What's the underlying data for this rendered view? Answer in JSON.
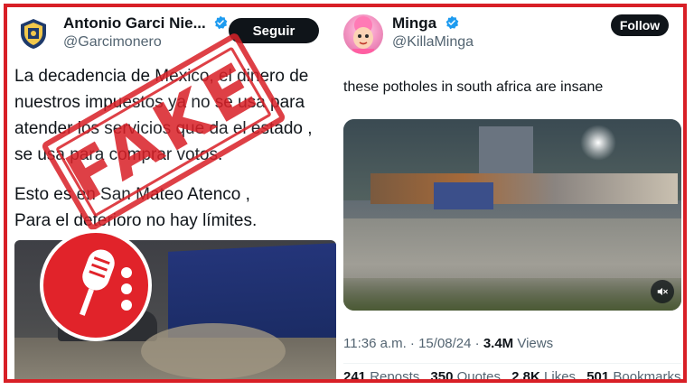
{
  "left_tweet": {
    "name": "Antonio Garci Nie...",
    "handle": "@Garcimonero",
    "follow_label": "Seguir",
    "text_lines": [
      "La decadencia de Mexico, el dinero de",
      "nuestros impuestos ya no se usa para",
      "atender los servicios que da el estado ,",
      "se usa para comprar votos.",
      "Esto es en San Mateo Atenco ,",
      "Para el deterioro no hay límites."
    ],
    "video_progress_fraction": 1.0
  },
  "stamp": {
    "text": "FAKE"
  },
  "logo": {
    "icon": "microphone-icon"
  },
  "right_tweet": {
    "name": "Minga",
    "handle": "@KillaMinga",
    "follow_label": "Follow",
    "text": "these potholes in south africa are insane",
    "time": "11:36 a.m. · 15/08/24 · ",
    "views_count": "3.4M",
    "views_label": " Views",
    "stats": [
      {
        "count": "241",
        "label": "Reposts"
      },
      {
        "count": "350",
        "label": "Quotes"
      },
      {
        "count": "2.8K",
        "label": "Likes"
      },
      {
        "count": "501",
        "label": "Bookmarks"
      }
    ]
  },
  "colors": {
    "frame_red": "#d81f26",
    "verified_blue": "#1d9bf0",
    "text_dark": "#0f1419",
    "text_gray": "#536471"
  }
}
